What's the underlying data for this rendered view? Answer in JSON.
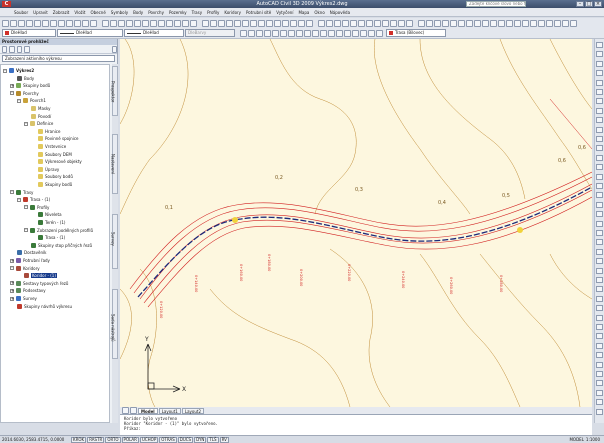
{
  "window": {
    "title": "AutoCAD Civil 3D 2009 Výkres2.dwg",
    "help_placeholder": "Zadejte klíčové slovo nebo frázi",
    "logo": "C"
  },
  "menu": [
    "Soubor",
    "Upravit",
    "Zobrazit",
    "Vložit",
    "Obecné",
    "Symboly",
    "Body",
    "Povrchy",
    "Pozemky",
    "Trasy",
    "Profily",
    "Koridory",
    "Potrubní sítě",
    "Vytyčení",
    "Mapa",
    "Okno",
    "Nápověda"
  ],
  "toolbar2": {
    "layer_name": "Trasa (Bilovec)",
    "bylayer": "DleHlad",
    "linetype": "DleHlad",
    "lineweight": "DleHlad",
    "plotstyle": "DleBarvy"
  },
  "panel": {
    "title": "Prostorové prohlížeč",
    "view_combo": "Zobrazení aktivního výkresu",
    "side_tabs": [
      "Prospektor",
      "Nastavení",
      "Survey",
      "Sada nástrojů"
    ],
    "tree": [
      {
        "label": "Výkres2",
        "indent": 0,
        "icon": "drawing-icon",
        "color": "#3a6fc4",
        "exp": "-",
        "bold": true
      },
      {
        "label": "Body",
        "indent": 1,
        "icon": "points-icon",
        "color": "#555"
      },
      {
        "label": "Skupiny bodů",
        "indent": 1,
        "icon": "point-groups-icon",
        "color": "#7a5",
        "exp": "+"
      },
      {
        "label": "Povrchy",
        "indent": 1,
        "icon": "surfaces-icon",
        "color": "#b58b2b",
        "exp": "-"
      },
      {
        "label": "Povrch1",
        "indent": 2,
        "icon": "surface-icon",
        "color": "#c9a23a",
        "exp": "-"
      },
      {
        "label": "Masky",
        "indent": 3,
        "icon": "masks-icon",
        "color": "#d9c36a"
      },
      {
        "label": "Povodí",
        "indent": 3,
        "icon": "watersheds-icon",
        "color": "#d9c36a"
      },
      {
        "label": "Definice",
        "indent": 3,
        "icon": "definition-icon",
        "color": "#d9c36a",
        "exp": "-"
      },
      {
        "label": "Hranice",
        "indent": 4,
        "icon": "boundaries-icon",
        "color": "#e2c95c"
      },
      {
        "label": "Povinné spojnice",
        "indent": 4,
        "icon": "breaklines-icon",
        "color": "#e2c95c"
      },
      {
        "label": "Vrstevnice",
        "indent": 4,
        "icon": "contours-icon",
        "color": "#e2c95c"
      },
      {
        "label": "Soubory DEM",
        "indent": 4,
        "icon": "dem-files-icon",
        "color": "#e2c95c"
      },
      {
        "label": "Výkresové objekty",
        "indent": 4,
        "icon": "drawing-objects-icon",
        "color": "#e2c95c"
      },
      {
        "label": "Úpravy",
        "indent": 4,
        "icon": "edits-icon",
        "color": "#e2c95c"
      },
      {
        "label": "Soubory bodů",
        "indent": 4,
        "icon": "point-files-icon",
        "color": "#e2c95c"
      },
      {
        "label": "Skupiny bodů",
        "indent": 4,
        "icon": "point-groups-icon",
        "color": "#e2c95c"
      },
      {
        "label": "Trasy",
        "indent": 1,
        "icon": "alignments-icon",
        "color": "#3a7a3a",
        "exp": "-"
      },
      {
        "label": "Trasa - (1)",
        "indent": 2,
        "icon": "alignment-icon",
        "color": "#c0392b",
        "exp": "-"
      },
      {
        "label": "Profily",
        "indent": 3,
        "icon": "profiles-icon",
        "color": "#3a7a3a",
        "exp": "-"
      },
      {
        "label": "Niveleta",
        "indent": 4,
        "icon": "profile-icon",
        "color": "#3a7a3a"
      },
      {
        "label": "Terén - (1)",
        "indent": 4,
        "icon": "profile-icon",
        "color": "#3a7a3a"
      },
      {
        "label": "Zobrazení podélných profilů",
        "indent": 3,
        "icon": "profile-views-icon",
        "color": "#3a7a3a",
        "exp": "-"
      },
      {
        "label": "Trasa - (1)",
        "indent": 4,
        "icon": "profile-view-icon",
        "color": "#3a7a3a"
      },
      {
        "label": "Skupiny stop příčných řezů",
        "indent": 3,
        "icon": "sample-lines-icon",
        "color": "#3a7a3a"
      },
      {
        "label": "Dostavěník",
        "indent": 1,
        "icon": "sites-icon",
        "color": "#3b6ea8"
      },
      {
        "label": "Potrubní řady",
        "indent": 1,
        "icon": "pipe-networks-icon",
        "color": "#7a5ca8",
        "exp": "+"
      },
      {
        "label": "Koridory",
        "indent": 1,
        "icon": "corridors-icon",
        "color": "#a84a3b",
        "exp": "-"
      },
      {
        "label": "Koridor - (1)",
        "indent": 2,
        "icon": "corridor-icon",
        "color": "#a84a3b",
        "selected": true
      },
      {
        "label": "Sestavy typových řezů",
        "indent": 1,
        "icon": "assemblies-icon",
        "color": "#5a8a5a",
        "exp": "+"
      },
      {
        "label": "Podsestavy",
        "indent": 1,
        "icon": "subassemblies-icon",
        "color": "#5a8a5a",
        "exp": "+"
      },
      {
        "label": "Survey",
        "indent": 1,
        "icon": "survey-icon",
        "color": "#3a6fc4",
        "exp": "+"
      },
      {
        "label": "Skupiny návrhů výkresu",
        "indent": 1,
        "icon": "view-frame-groups-icon",
        "color": "#c0392b"
      }
    ]
  },
  "drawing": {
    "contour_labels": [
      "0,1",
      "0,2",
      "0,3",
      "0,4",
      "0,5",
      "0,6",
      "0,6"
    ],
    "station_labels": [
      "0+120.00",
      "0+140.00",
      "0+160.00",
      "0+180.00",
      "0+200.00",
      "0+220.00",
      "0+240.00",
      "0+260.00",
      "0+280.00"
    ],
    "ucs_x": "X",
    "ucs_y": "Y"
  },
  "layout_tabs": [
    "Model",
    "Layout1",
    "Layout2"
  ],
  "command_lines": [
    "Koridor bylo vytvořeno",
    "Koridor \"Koridor - (1)\" bylo vytvořeno.",
    "Příkaz:"
  ],
  "status": {
    "coords": "2014.6030, 2583.4715, 0.0000",
    "buttons": [
      "KROK",
      "RASTR",
      "ORTO",
      "POLAR",
      "UCHOP",
      "OTRAS",
      "DUCS",
      "DYN",
      "TLŠ",
      "RV"
    ],
    "model_label": "MODEL",
    "scale": "1:1000"
  },
  "colors": {
    "canvas": "#fdf7df",
    "road": "#d11f1f",
    "centerline": "#1b2a7a",
    "contour": "#c08c35",
    "selection": "#173b8c"
  }
}
